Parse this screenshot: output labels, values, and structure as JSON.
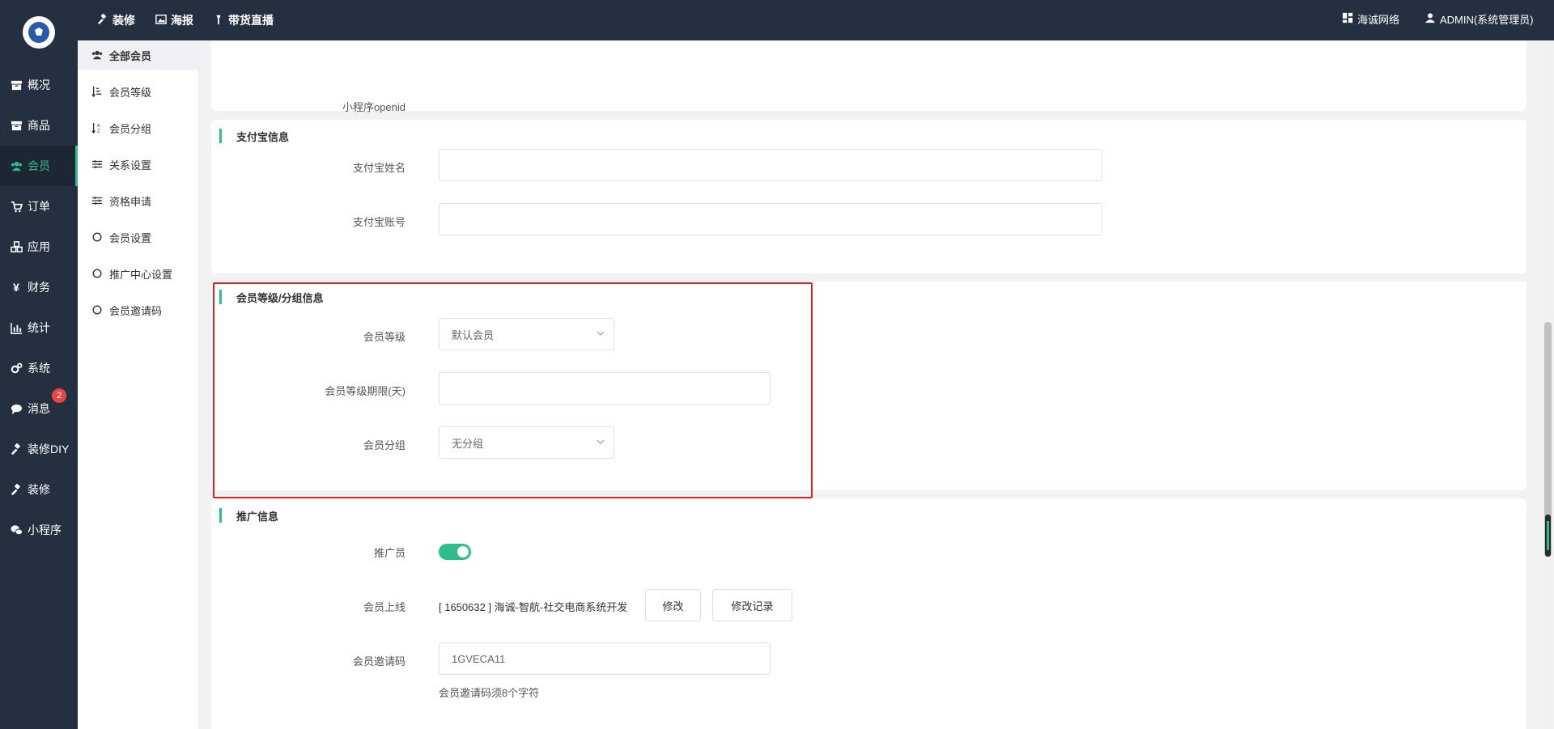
{
  "sidebar": {
    "items": [
      {
        "label": "概况",
        "icon": "archive-icon"
      },
      {
        "label": "商品",
        "icon": "archive-icon"
      },
      {
        "label": "会员",
        "icon": "users-icon"
      },
      {
        "label": "订单",
        "icon": "cart-icon"
      },
      {
        "label": "应用",
        "icon": "cubes-icon"
      },
      {
        "label": "财务",
        "icon": "yen-icon"
      },
      {
        "label": "统计",
        "icon": "bar-chart-icon"
      },
      {
        "label": "系统",
        "icon": "gears-icon"
      },
      {
        "label": "消息",
        "icon": "comment-icon",
        "badge": "2"
      },
      {
        "label": "装修DIY",
        "icon": "gavel-icon"
      },
      {
        "label": "装修",
        "icon": "gavel-icon"
      },
      {
        "label": "小程序",
        "icon": "wechat-icon"
      }
    ],
    "active": "会员"
  },
  "topbar": {
    "links": [
      {
        "label": "装修",
        "icon": "gavel-icon"
      },
      {
        "label": "海报",
        "icon": "image-icon"
      },
      {
        "label": "带货直播",
        "icon": "torch-icon"
      }
    ],
    "brand": "海诚网络",
    "user": "ADMIN(系统管理员)"
  },
  "subnav": {
    "items": [
      {
        "label": "全部会员",
        "icon": "users-icon"
      },
      {
        "label": "会员等级",
        "icon": "sort-amount-icon"
      },
      {
        "label": "会员分组",
        "icon": "sort-alpha-icon"
      },
      {
        "label": "关系设置",
        "icon": "sliders-icon"
      },
      {
        "label": "资格申请",
        "icon": "sliders-icon"
      },
      {
        "label": "会员设置",
        "icon": "circle-icon"
      },
      {
        "label": "推广中心设置",
        "icon": "circle-icon"
      },
      {
        "label": "会员邀请码",
        "icon": "circle-icon"
      }
    ],
    "active": "全部会员"
  },
  "form": {
    "openid_label": "小程序openid",
    "alipay": {
      "title": "支付宝信息",
      "name_label": "支付宝姓名",
      "name_value": "",
      "account_label": "支付宝账号",
      "account_value": ""
    },
    "level_group": {
      "title": "会员等级/分组信息",
      "level_label": "会员等级",
      "level_value": "默认会员",
      "duration_label": "会员等级期限(天)",
      "duration_value": "",
      "group_label": "会员分组",
      "group_value": "无分组"
    },
    "promotion": {
      "title": "推广信息",
      "promoter_label": "推广员",
      "promoter_on": true,
      "parent_label": "会员上线",
      "parent_value": "[ 1650632 ] 海诚-智航-社交电商系统开发",
      "modify_button": "修改",
      "history_button": "修改记录",
      "invite_label": "会员邀请码",
      "invite_value": "1GVECA11",
      "invite_hint": "会员邀请码须8个字符"
    }
  },
  "colors": {
    "accent": "#2dbd8f",
    "sidebar_bg": "#243040",
    "highlight": "#e02020",
    "badge": "#e84545"
  }
}
